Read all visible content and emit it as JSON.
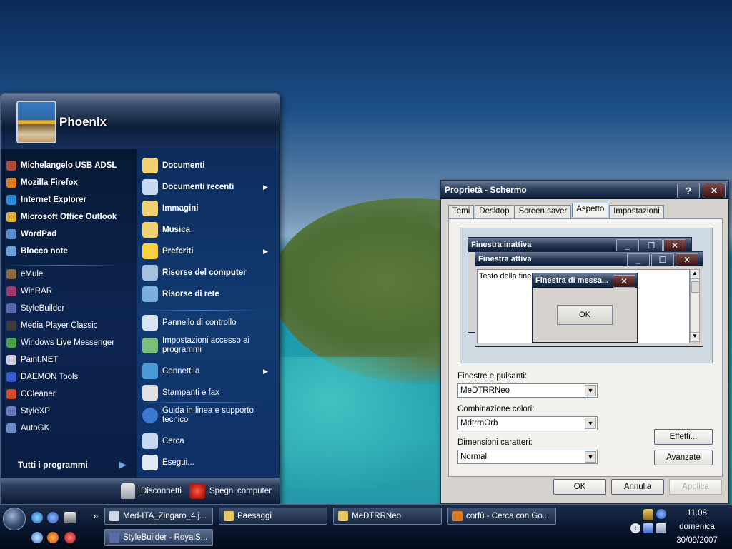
{
  "start_menu": {
    "user_name": "Phoenix",
    "pinned": [
      {
        "label": "Michelangelo USB ADSL",
        "icon": "modem-icon",
        "color": "#b04a3a"
      },
      {
        "label": "Mozilla Firefox",
        "icon": "firefox-icon",
        "color": "#e07a20"
      },
      {
        "label": "Internet Explorer",
        "icon": "ie-icon",
        "color": "#2d8ad6"
      },
      {
        "label": "Microsoft Office Outlook",
        "icon": "outlook-icon",
        "color": "#e2b13c"
      },
      {
        "label": "WordPad",
        "icon": "wordpad-icon",
        "color": "#5c8dd0"
      },
      {
        "label": "Blocco note",
        "icon": "notepad-icon",
        "color": "#6aa0d8"
      }
    ],
    "recent": [
      {
        "label": "eMule",
        "icon": "emule-icon",
        "color": "#8a6a3a"
      },
      {
        "label": "WinRAR",
        "icon": "winrar-icon",
        "color": "#a03a6a"
      },
      {
        "label": "StyleBuilder",
        "icon": "stylebuilder-icon",
        "color": "#5a6aa8"
      },
      {
        "label": "Media Player Classic",
        "icon": "mpc-icon",
        "color": "#3a3a3a"
      },
      {
        "label": "Windows Live Messenger",
        "icon": "messenger-icon",
        "color": "#4aa04a"
      },
      {
        "label": "Paint.NET",
        "icon": "paintnet-icon",
        "color": "#d0d0e0"
      },
      {
        "label": "DAEMON Tools",
        "icon": "daemon-icon",
        "color": "#3a5ad0"
      },
      {
        "label": "CCleaner",
        "icon": "ccleaner-icon",
        "color": "#d04a2a"
      },
      {
        "label": "StyleXP",
        "icon": "stylexp-icon",
        "color": "#6a7ab8"
      },
      {
        "label": "AutoGK",
        "icon": "autogk-icon",
        "color": "#6a8ac8"
      }
    ],
    "all_programs": "Tutti i programmi",
    "places": [
      {
        "label": "Documenti",
        "icon": "documents-folder-icon",
        "bold": true,
        "arrow": false
      },
      {
        "label": "Documenti recenti",
        "icon": "recent-documents-icon",
        "bold": true,
        "arrow": true
      },
      {
        "label": "Immagini",
        "icon": "pictures-folder-icon",
        "bold": true,
        "arrow": false
      },
      {
        "label": "Musica",
        "icon": "music-folder-icon",
        "bold": true,
        "arrow": false
      },
      {
        "label": "Preferiti",
        "icon": "favorites-star-icon",
        "bold": true,
        "arrow": true
      },
      {
        "label": "Risorse del computer",
        "icon": "my-computer-icon",
        "bold": true,
        "arrow": false
      },
      {
        "label": "Risorse di rete",
        "icon": "network-icon",
        "bold": true,
        "arrow": false
      }
    ],
    "system": [
      {
        "label": "Pannello di controllo",
        "icon": "control-panel-icon",
        "arrow": false
      },
      {
        "label": "Impostazioni accesso ai programmi",
        "icon": "program-access-icon",
        "arrow": false
      },
      {
        "label": "Connetti a",
        "icon": "connect-to-icon",
        "arrow": true
      },
      {
        "label": "Stampanti e fax",
        "icon": "printer-icon",
        "arrow": false
      }
    ],
    "help": [
      {
        "label": "Guida in linea e supporto tecnico",
        "icon": "help-icon"
      },
      {
        "label": "Cerca",
        "icon": "search-icon"
      },
      {
        "label": "Esegui...",
        "icon": "run-icon"
      }
    ],
    "footer": {
      "logoff": "Disconnetti",
      "shutdown": "Spegni computer"
    }
  },
  "dialog": {
    "title": "Proprietà - Schermo",
    "help_button": "?",
    "close_button": "✕",
    "tabs": [
      "Temi",
      "Desktop",
      "Screen saver",
      "Aspetto",
      "Impostazioni"
    ],
    "active_tab": "Aspetto",
    "preview": {
      "inactive_title": "Finestra inattiva",
      "active_title": "Finestra attiva",
      "window_text": "Testo della finestra",
      "message_title": "Finestra di messa...",
      "ok": "OK"
    },
    "fields": [
      {
        "label": "Finestre e pulsanti:",
        "value": "MeDTRRNeo"
      },
      {
        "label": "Combinazione colori:",
        "value": "MdtrrnOrb"
      },
      {
        "label": "Dimensioni caratteri:",
        "value": "Normal"
      }
    ],
    "effects_button": "Effetti...",
    "advanced_button": "Avanzate",
    "ok_button": "OK",
    "cancel_button": "Annulla",
    "apply_button": "Applica"
  },
  "taskbar": {
    "tasks_row1": [
      {
        "label": "Med-ITA_Zingaro_4.j...",
        "icon": "image-file-icon",
        "color": "#d0d8e8"
      },
      {
        "label": "Paesaggi",
        "icon": "folder-icon",
        "color": "#e8c860"
      },
      {
        "label": "MeDTRRNeo",
        "icon": "folder-icon",
        "color": "#e8c860"
      },
      {
        "label": "corfù - Cerca con Go...",
        "icon": "firefox-icon",
        "color": "#e07a20"
      }
    ],
    "tasks_row2": [
      {
        "label": "StyleBuilder - RoyalS...",
        "icon": "stylebuilder-icon",
        "color": "#5a6aa8"
      }
    ],
    "expand_quicklaunch": "»",
    "tray_expand": "‹",
    "clock": {
      "time": "11.08",
      "day": "domenica",
      "date": "30/09/2007"
    }
  }
}
